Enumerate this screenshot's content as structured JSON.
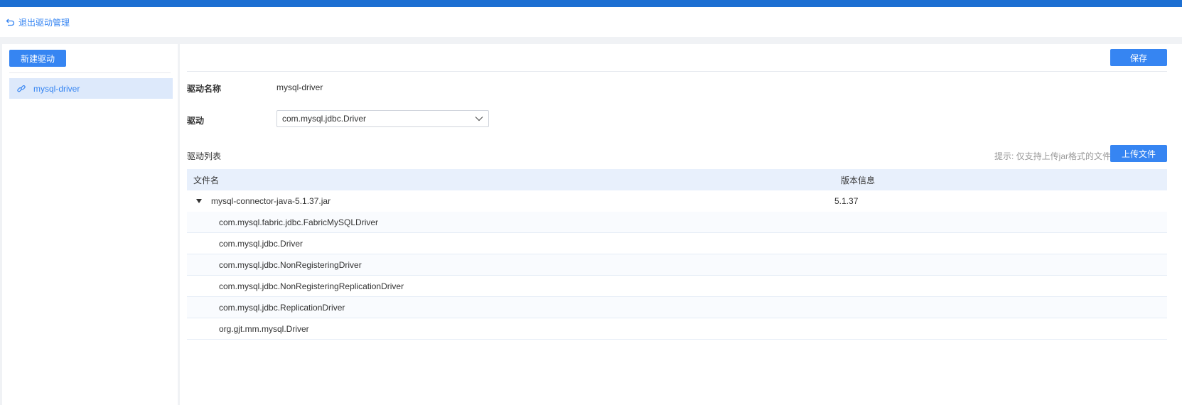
{
  "header": {
    "back_label": "退出驱动管理"
  },
  "sidebar": {
    "new_button": "新建驱动",
    "items": [
      {
        "label": "mysql-driver",
        "icon": "link-icon",
        "selected": true
      }
    ]
  },
  "main": {
    "save_button": "保存",
    "form": {
      "name_label": "驱动名称",
      "name_value": "mysql-driver",
      "driver_label": "驱动",
      "driver_selected": "com.mysql.jdbc.Driver"
    },
    "list": {
      "title": "驱动列表",
      "hint": "提示: 仅支持上传jar格式的文件",
      "upload_button": "上传文件",
      "columns": [
        "文件名",
        "版本信息"
      ],
      "jar": {
        "name": "mysql-connector-java-5.1.37.jar",
        "version": "5.1.37"
      },
      "classes": [
        "com.mysql.fabric.jdbc.FabricMySQLDriver",
        "com.mysql.jdbc.Driver",
        "com.mysql.jdbc.NonRegisteringDriver",
        "com.mysql.jdbc.NonRegisteringReplicationDriver",
        "com.mysql.jdbc.ReplicationDriver",
        "org.gjt.mm.mysql.Driver"
      ]
    }
  },
  "colors": {
    "accent": "#3685f2",
    "topbar": "#1d6fd2",
    "selected_bg": "#dde9fb",
    "table_header_bg": "#e8f0fc"
  }
}
